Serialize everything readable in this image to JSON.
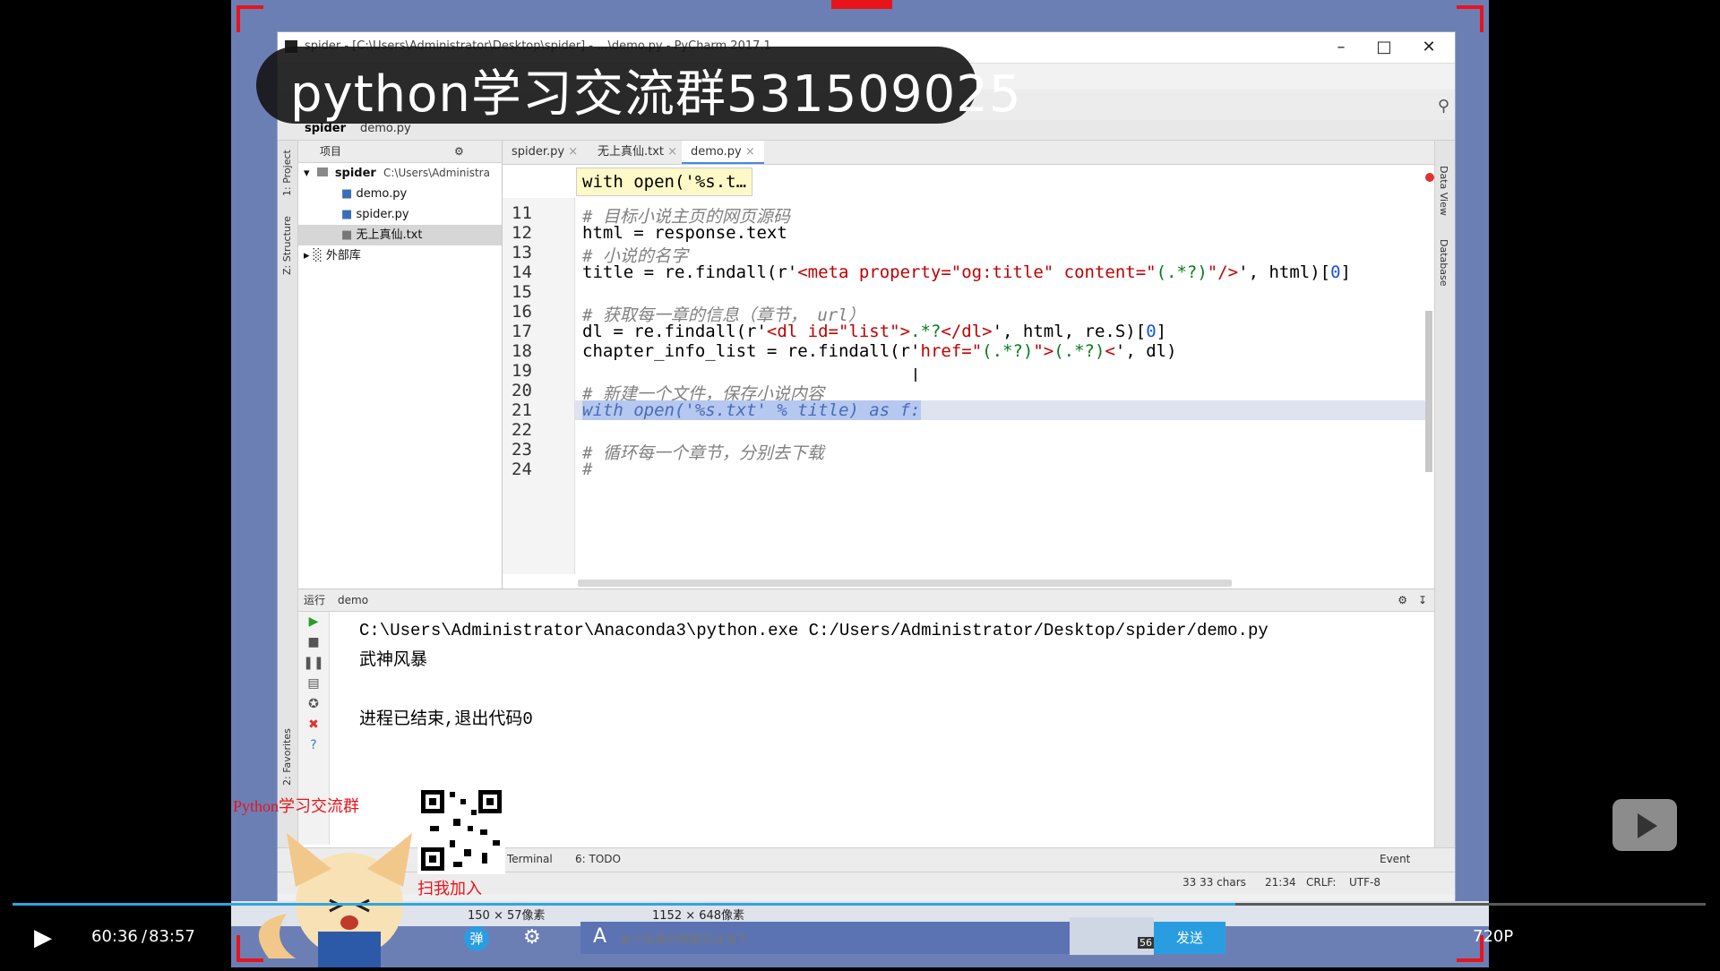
{
  "window": {
    "title": "spider - [C:\\Users\\Administrator\\Desktop\\spider] - ...\\demo.py - PyCharm 2017.1",
    "min": "–",
    "max": "□",
    "close": "✕"
  },
  "overlay": {
    "group_title": "python学习交流群531509025"
  },
  "nav": {
    "project": "spider",
    "file": "demo.py"
  },
  "sidebar_left": {
    "project_tab": "1: Project",
    "structure_tab": "Z: Structure",
    "favorites_tab": "2: Favorites"
  },
  "sidebar_right": {
    "data_view": "Data View",
    "database": "Database"
  },
  "project": {
    "header": "项目",
    "root": "spider",
    "root_path": "C:\\Users\\Administra",
    "files": [
      "demo.py",
      "spider.py",
      "无上真仙.txt"
    ],
    "external": "外部库"
  },
  "tabs": [
    "spider.py",
    "无上真仙.txt",
    "demo.py"
  ],
  "hint": "with open('%s.t…",
  "code": {
    "line_numbers": [
      "11",
      "12",
      "13",
      "14",
      "15",
      "16",
      "17",
      "18",
      "19",
      "20",
      "21",
      "22",
      "23",
      "24"
    ],
    "l11": "# 目标小说主页的网页源码",
    "l12": "html = response.text",
    "l13": "# 小说的名字",
    "l14a": "title = re.findall(r'",
    "l14b": "<meta property=\"og:title\" content=\"",
    "l14c": "(.*?)",
    "l14d": "\"/>",
    "l14e": "', html)[",
    "l14f": "0",
    "l14g": "]",
    "l16": "# 获取每一章的信息（章节， url）",
    "l17a": "dl = re.findall(r'",
    "l17b": "<dl id=\"list\">",
    "l17c": ".*?",
    "l17d": "</dl>",
    "l17e": "', html, re.S)[",
    "l17f": "0",
    "l17g": "]",
    "l18a": "chapter_info_list = re.findall(r'",
    "l18b": "href=\"",
    "l18c": "(.*?)",
    "l18d": "\">",
    "l18e": "(.*?)",
    "l18f": "<",
    "l18g": "', dl)",
    "l20": "# 新建一个文件，保存小说内容",
    "l21": "with open('%s.txt' % title) as f:",
    "l23": "# 循环每一个章节，分别去下载",
    "l24": "#"
  },
  "run": {
    "label": "运行",
    "config": "demo",
    "cmd": "C:\\Users\\Administrator\\Anaconda3\\python.exe C:/Users/Administrator/Desktop/spider/demo.py",
    "out1": "武神风暴",
    "exit": "进程已结束,退出代码0"
  },
  "bottom_tools": {
    "terminal": "Terminal",
    "todo": "6: TODO",
    "event": "Event"
  },
  "status": {
    "chars": "33 33 chars",
    "pos": "21:34",
    "crlf": "CRLF:",
    "enc": "UTF-8"
  },
  "desktop": {
    "size1": "150 × 57像素",
    "size2": "1152 × 648像素"
  },
  "promo": {
    "group": "Python学习交流群",
    "scan": "扫我加入"
  },
  "player": {
    "current": "60:36",
    "sep": "/",
    "total": "83:57",
    "progress": 0.722,
    "danmu_toggle": "弹",
    "danmu_placeholder": "发个友善的弹幕见证当下",
    "send": "发送",
    "quality": "720P",
    "thumb_count": "56"
  }
}
